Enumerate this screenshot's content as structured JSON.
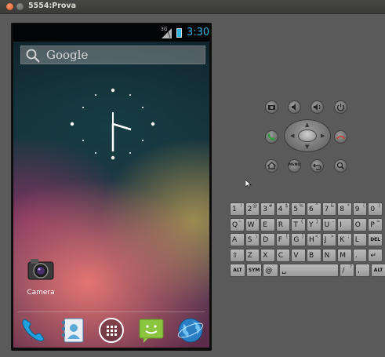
{
  "window": {
    "title": "5554:Prova"
  },
  "status_bar": {
    "network": "3G",
    "time": "3:30"
  },
  "search_bar": {
    "text": "Google"
  },
  "home_apps": [
    {
      "label": "Camera"
    }
  ],
  "dock": [
    "phone-icon",
    "contacts-icon",
    "all-apps-icon",
    "messaging-icon",
    "browser-icon"
  ],
  "controls": {
    "row1": [
      "camera-icon",
      "volume-down-icon",
      "volume-up-icon",
      "power-icon"
    ],
    "row2": [
      "call-icon",
      "dpad",
      "end-call-icon"
    ],
    "row3": [
      "home-icon",
      "menu-button",
      "back-icon",
      "search-icon"
    ],
    "menu_label": "MENU"
  },
  "keyboard": {
    "row1": [
      {
        "main": "1",
        "sec": "!"
      },
      {
        "main": "2",
        "sec": "@"
      },
      {
        "main": "3",
        "sec": "#"
      },
      {
        "main": "4",
        "sec": "$"
      },
      {
        "main": "5",
        "sec": "%"
      },
      {
        "main": "6",
        "sec": "^"
      },
      {
        "main": "7",
        "sec": "&"
      },
      {
        "main": "8",
        "sec": "*"
      },
      {
        "main": "9",
        "sec": "("
      },
      {
        "main": "0",
        "sec": ")"
      }
    ],
    "row2": [
      {
        "main": "Q",
        "sec": "~"
      },
      {
        "main": "W",
        "sec": "\""
      },
      {
        "main": "E",
        "sec": ""
      },
      {
        "main": "R",
        "sec": ""
      },
      {
        "main": "T",
        "sec": "{"
      },
      {
        "main": "Y",
        "sec": "}"
      },
      {
        "main": "U",
        "sec": "-"
      },
      {
        "main": "I",
        "sec": ""
      },
      {
        "main": "O",
        "sec": ""
      },
      {
        "main": "P",
        "sec": "="
      }
    ],
    "row3": [
      {
        "main": "A",
        "sec": ""
      },
      {
        "main": "S",
        "sec": "\\"
      },
      {
        "main": "D",
        "sec": ""
      },
      {
        "main": "F",
        "sec": "["
      },
      {
        "main": "G",
        "sec": "]"
      },
      {
        "main": "H",
        "sec": "<"
      },
      {
        "main": "J",
        "sec": ">"
      },
      {
        "main": "K",
        "sec": ";"
      },
      {
        "main": "L",
        "sec": ":"
      },
      {
        "main": "DEL",
        "sec": ""
      }
    ],
    "row4": [
      {
        "main": "⇧",
        "sec": ""
      },
      {
        "main": "Z",
        "sec": ""
      },
      {
        "main": "X",
        "sec": ""
      },
      {
        "main": "C",
        "sec": ""
      },
      {
        "main": "V",
        "sec": ""
      },
      {
        "main": "B",
        "sec": ""
      },
      {
        "main": "N",
        "sec": ""
      },
      {
        "main": "M",
        "sec": ""
      },
      {
        "main": ".",
        "sec": ""
      },
      {
        "main": "↵",
        "sec": ""
      }
    ],
    "row5": [
      {
        "main": "ALT",
        "sec": ""
      },
      {
        "main": "SYM",
        "sec": ""
      },
      {
        "main": "@",
        "sec": ""
      },
      {
        "main": "␣",
        "sec": ""
      },
      {
        "main": "/",
        "sec": "?"
      },
      {
        "main": ",",
        "sec": ""
      },
      {
        "main": "ALT",
        "sec": ""
      }
    ]
  }
}
